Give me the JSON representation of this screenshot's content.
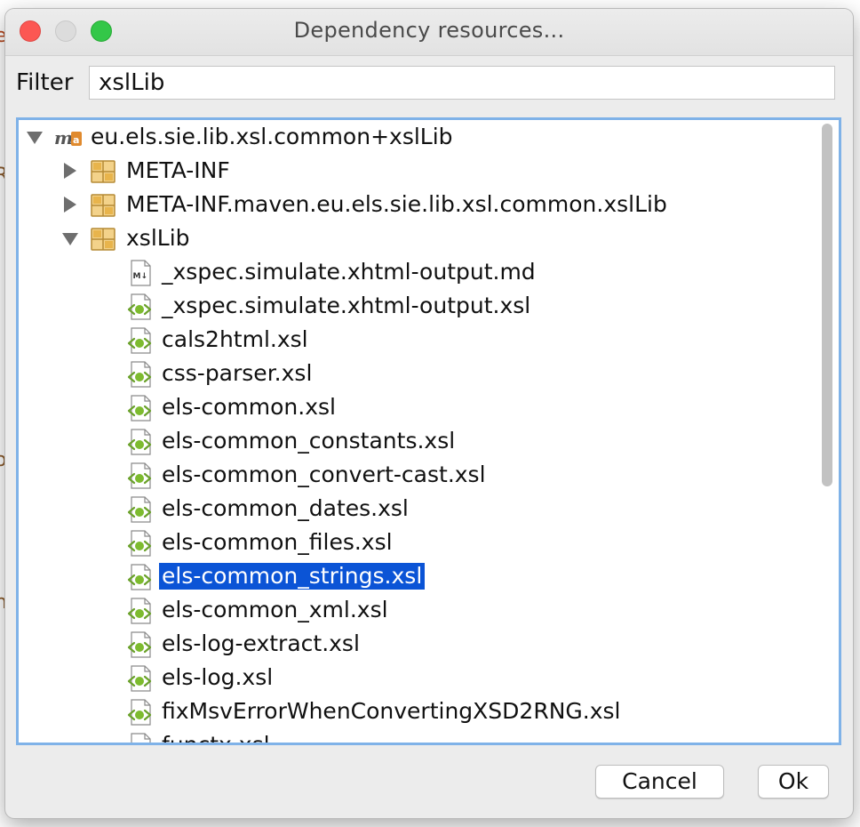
{
  "window": {
    "title": "Dependency resources..."
  },
  "filter": {
    "label": "Filter",
    "value": "xslLib"
  },
  "tree": {
    "root": {
      "label": "eu.els.sie.lib.xsl.common+xslLib",
      "icon": "maven-archive-icon",
      "expanded": true
    },
    "folders": [
      {
        "label": "META-INF",
        "icon": "package-folder-icon",
        "expanded": false
      },
      {
        "label": "META-INF.maven.eu.els.sie.lib.xsl.common.xslLib",
        "icon": "package-folder-icon",
        "expanded": false
      },
      {
        "label": "xslLib",
        "icon": "package-folder-icon",
        "expanded": true
      }
    ],
    "files": [
      {
        "label": "_xspec.simulate.xhtml-output.md",
        "icon": "markdown-file-icon",
        "selected": false
      },
      {
        "label": "_xspec.simulate.xhtml-output.xsl",
        "icon": "xsl-file-icon",
        "selected": false
      },
      {
        "label": "cals2html.xsl",
        "icon": "xsl-file-icon",
        "selected": false
      },
      {
        "label": "css-parser.xsl",
        "icon": "xsl-file-icon",
        "selected": false
      },
      {
        "label": "els-common.xsl",
        "icon": "xsl-file-icon",
        "selected": false
      },
      {
        "label": "els-common_constants.xsl",
        "icon": "xsl-file-icon",
        "selected": false
      },
      {
        "label": "els-common_convert-cast.xsl",
        "icon": "xsl-file-icon",
        "selected": false
      },
      {
        "label": "els-common_dates.xsl",
        "icon": "xsl-file-icon",
        "selected": false
      },
      {
        "label": "els-common_files.xsl",
        "icon": "xsl-file-icon",
        "selected": false
      },
      {
        "label": "els-common_strings.xsl",
        "icon": "xsl-file-icon",
        "selected": true
      },
      {
        "label": "els-common_xml.xsl",
        "icon": "xsl-file-icon",
        "selected": false
      },
      {
        "label": "els-log-extract.xsl",
        "icon": "xsl-file-icon",
        "selected": false
      },
      {
        "label": "els-log.xsl",
        "icon": "xsl-file-icon",
        "selected": false
      },
      {
        "label": "fixMsvErrorWhenConvertingXSD2RNG.xsl",
        "icon": "xsl-file-icon",
        "selected": false
      },
      {
        "label": "functx.xsl",
        "icon": "xsl-file-icon",
        "selected": false
      }
    ]
  },
  "buttons": {
    "cancel": "Cancel",
    "ok": "Ok"
  },
  "colors": {
    "selection": "#0b54d6",
    "focus_border": "#7fb2e8",
    "close": "#fc5753",
    "maximize": "#33c748"
  }
}
